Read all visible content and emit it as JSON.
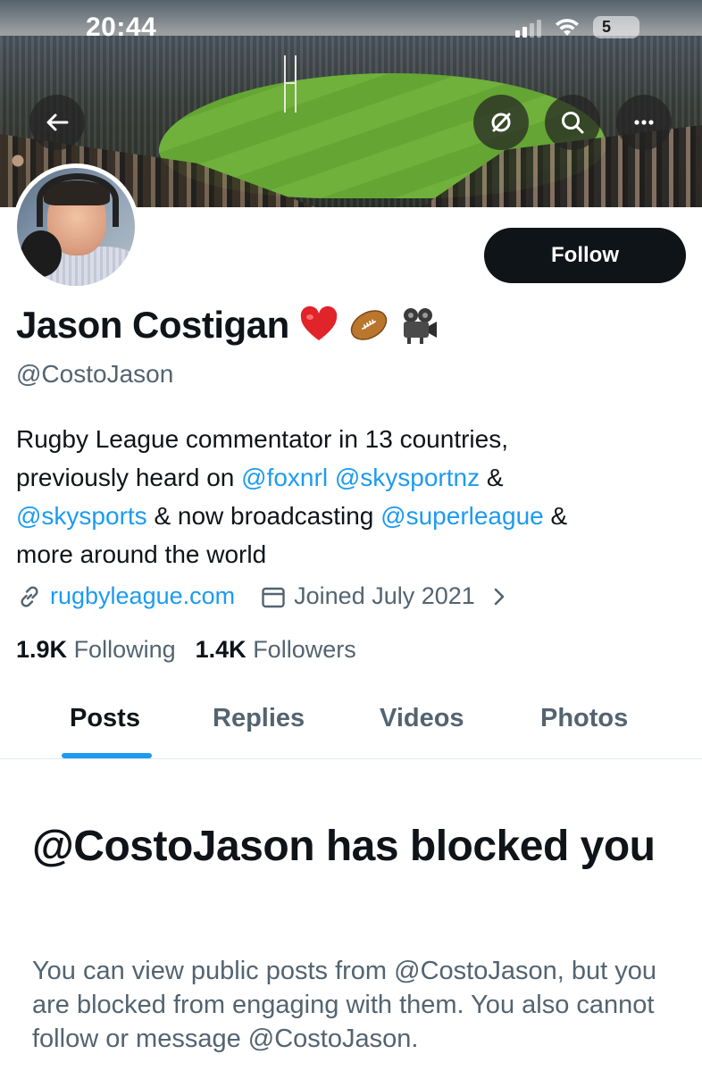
{
  "status_bar": {
    "time": "20:44",
    "battery": "5"
  },
  "header": {
    "back_icon": "arrow-left-icon",
    "grok_icon": "grok-icon",
    "search_icon": "search-icon",
    "more_icon": "more-horizontal-icon"
  },
  "profile": {
    "display_name": "Jason Costigan",
    "name_emojis": [
      "red-heart-emoji",
      "rugby-ball-emoji",
      "movie-camera-emoji"
    ],
    "handle": "@CostoJason",
    "follow_label": "Follow",
    "bio": {
      "line1": "Rugby League commentator in 13 countries,",
      "line2_pre": "previously heard on ",
      "mention1": "@foxnrl",
      "mention2": "@skysportnz",
      "amp1": " &",
      "mention3": "@skysports",
      "line3_mid": " & now broadcasting ",
      "mention4": "@superleague",
      "amp2": " &",
      "line4": "more around the world"
    },
    "website": "rugbyleague.com",
    "joined": "Joined July 2021",
    "following_count": "1.9K",
    "following_label": "Following",
    "followers_count": "1.4K",
    "followers_label": "Followers"
  },
  "tabs": [
    {
      "label": "Posts",
      "active": true
    },
    {
      "label": "Replies",
      "active": false
    },
    {
      "label": "Videos",
      "active": false
    },
    {
      "label": "Photos",
      "active": false
    }
  ],
  "blocked_notice": {
    "title": "@CostoJason has blocked you",
    "body": "You can view public posts from @CostoJason, but you are blocked from engaging with them. You also cannot follow or message @CostoJason."
  },
  "colors": {
    "accent": "#1d9bf0",
    "text_primary": "#0f1419",
    "text_secondary": "#536471",
    "follow_button_bg": "#0f1419"
  }
}
